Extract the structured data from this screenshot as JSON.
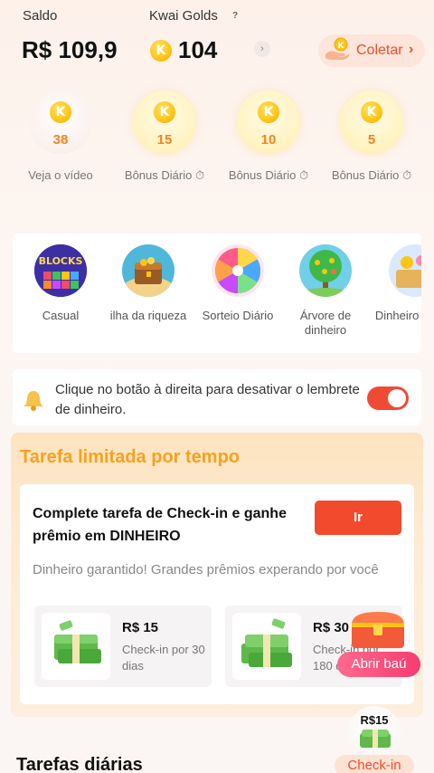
{
  "header": {
    "saldo_label": "Saldo",
    "saldo_value": "R$ 109,9",
    "golds_label": "Kwai Golds",
    "help_glyph": "?",
    "golds_value": "104",
    "coin_glyph": "K",
    "coletar_label": "Coletar",
    "coletar_chevron": "›"
  },
  "bonuses": [
    {
      "value": "38",
      "label": "Veja o vídeo",
      "icon": "coin-icon"
    },
    {
      "value": "15",
      "label": "Bônus Diário ⏱",
      "icon": "coin-icon"
    },
    {
      "value": "10",
      "label": "Bônus Diário ⏱",
      "icon": "coin-icon"
    },
    {
      "value": "5",
      "label": "Bônus Diário ⏱",
      "icon": "coin-icon"
    }
  ],
  "games": [
    {
      "label": "Casual",
      "icon": "blocks-game-icon"
    },
    {
      "label": "ilha da riqueza",
      "icon": "treasure-island-icon"
    },
    {
      "label": "Sorteio Diário",
      "icon": "prize-wheel-icon"
    },
    {
      "label": "Árvore de dinheiro",
      "icon": "money-tree-icon"
    },
    {
      "label": "Dinheiro rápido",
      "icon": "fast-money-icon"
    }
  ],
  "reminder": {
    "text": "Clique no botão à direita para desativar o lembrete de dinheiro.",
    "toggle_on": true
  },
  "limited": {
    "title": "Tarefa limitada por tempo",
    "task_title": "Complete tarefa de Check-in e ganhe prêmio em DINHEIRO",
    "go_button": "Ir",
    "subtitle": "Dinheiro garantido! Grandes prêmios experando por você",
    "prizes": [
      {
        "value": "R$ 15",
        "desc": "Check-in por 30 dias"
      },
      {
        "value": "R$ 30",
        "desc": "Check-in por 180 dias"
      }
    ]
  },
  "chest": {
    "label": "Abrir baú"
  },
  "daily": {
    "title": "Tarefas diárias",
    "checkin_value": "R$15",
    "checkin_label": "Check-in"
  },
  "colors": {
    "accent": "#f24a2c",
    "gold": "#ffc414",
    "limited_title": "#f9a11b"
  }
}
